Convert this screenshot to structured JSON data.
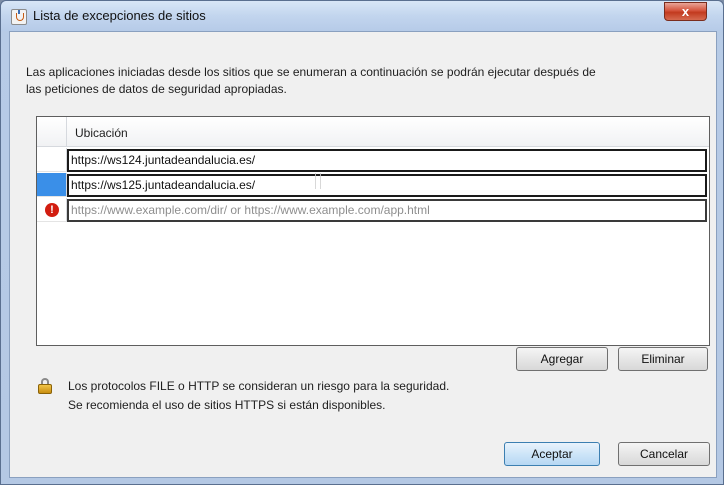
{
  "window": {
    "title": "Lista de excepciones de sitios",
    "close_label": "x"
  },
  "description": {
    "line1": "Las aplicaciones iniciadas desde los sitios que se enumeran a continuación se podrán ejecutar después de",
    "line2": "las peticiones de datos de seguridad apropiadas."
  },
  "table": {
    "column_header": "Ubicación",
    "rows": [
      {
        "value": "https://ws124.juntadeandalucia.es/",
        "selected": false,
        "error": false
      },
      {
        "value": "https://ws125.juntadeandalucia.es/",
        "selected": true,
        "error": false
      },
      {
        "value": "",
        "placeholder": "https://www.example.com/dir/ or https://www.example.com/app.html",
        "selected": false,
        "error": true,
        "error_icon": "!"
      }
    ]
  },
  "buttons": {
    "add": "Agregar",
    "remove": "Eliminar",
    "accept": "Aceptar",
    "cancel": "Cancelar"
  },
  "warning": {
    "line1": "Los protocolos FILE o HTTP se consideran un riesgo para la seguridad.",
    "line2": "Se recomienda el uso de sitios HTTPS si están disponibles."
  },
  "icons": {
    "app": "java-icon",
    "lock": "lock-icon",
    "error": "error-icon"
  },
  "colors": {
    "selection": "#3a8fe8",
    "error": "#d21d10",
    "default_button": "#3c7fb1"
  }
}
